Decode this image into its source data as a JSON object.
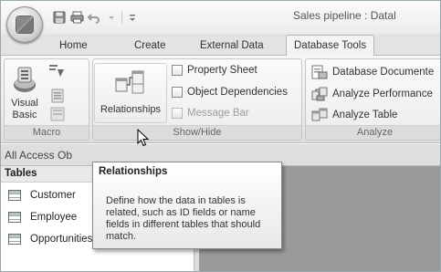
{
  "window": {
    "title": "Sales pipeline : Datal"
  },
  "quick_access": {
    "icons": [
      "save-icon",
      "print-icon",
      "undo-icon",
      "undo-dropdown-icon",
      "customize-qat-icon"
    ]
  },
  "tabs": [
    {
      "label": "Home",
      "active": false
    },
    {
      "label": "Create",
      "active": false
    },
    {
      "label": "External Data",
      "active": false
    },
    {
      "label": "Database Tools",
      "active": true
    }
  ],
  "ribbon": {
    "macro": {
      "group_label": "Macro",
      "visual_basic_label_line1": "Visual",
      "visual_basic_label_line2": "Basic"
    },
    "show_hide": {
      "group_label": "Show/Hide",
      "relationships_label": "Relationships",
      "property_sheet_label": "Property Sheet",
      "object_dependencies_label": "Object Dependencies",
      "message_bar_label": "Message Bar"
    },
    "analyze": {
      "group_label": "Analyze",
      "database_documenter_label": "Database Documente",
      "analyze_performance_label": "Analyze Performance",
      "analyze_table_label": "Analyze Table"
    }
  },
  "nav_pane": {
    "header": "All Access Ob",
    "group_header": "Tables",
    "items": [
      {
        "label": "Customer"
      },
      {
        "label": "Employee"
      },
      {
        "label": "Opportunities"
      }
    ]
  },
  "tooltip": {
    "title": "Relationships",
    "body": "Define how the data in tables is related, such as ID fields or name fields in different tables that should match."
  },
  "colors": {
    "ribbon_bg": "#ececec",
    "workspace_bg": "#9a9a9a",
    "tooltip_border": "#8a8a8a"
  }
}
